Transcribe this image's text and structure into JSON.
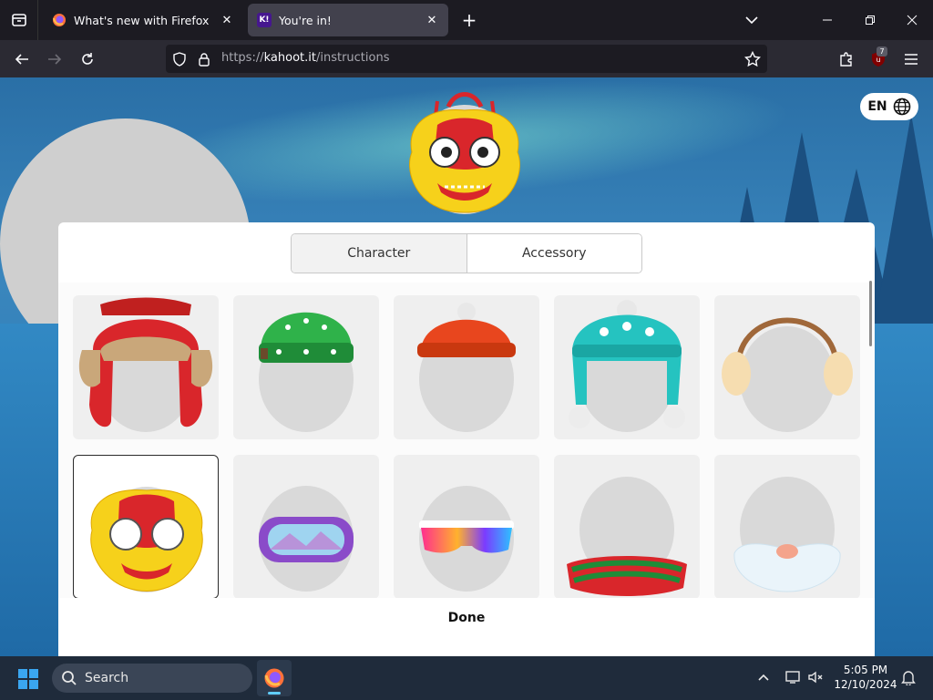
{
  "browser": {
    "tabs": [
      {
        "title": "What's new with Firefox",
        "active": false,
        "favicon": "firefox-icon"
      },
      {
        "title": "You're in!",
        "active": true,
        "favicon": "kahoot-icon",
        "favicon_text": "K!"
      }
    ],
    "url_prefix": "https://",
    "url_host": "kahoot.it",
    "url_path": "/instructions",
    "extension_badge": "7"
  },
  "page": {
    "language": "EN",
    "segmented": {
      "options": [
        "Character",
        "Accessory"
      ],
      "selected": "Character"
    },
    "done_label": "Done",
    "accessories": [
      {
        "name": "trapper-hat",
        "selected": false
      },
      {
        "name": "reindeer-beanie",
        "selected": false
      },
      {
        "name": "orange-beanie",
        "selected": false
      },
      {
        "name": "snowflake-bobble-hat",
        "selected": false
      },
      {
        "name": "earmuffs",
        "selected": false
      },
      {
        "name": "lion-dance-mask",
        "selected": true
      },
      {
        "name": "ski-goggles",
        "selected": false
      },
      {
        "name": "sport-sunglasses",
        "selected": false
      },
      {
        "name": "striped-scarf",
        "selected": false
      },
      {
        "name": "white-beard",
        "selected": false
      }
    ]
  },
  "taskbar": {
    "search_label": "Search",
    "time": "5:05 PM",
    "date": "12/10/2024"
  },
  "colors": {
    "accent": "#60cdff",
    "mask_red": "#d9262b",
    "mask_yellow": "#f6d11b",
    "head_gray": "#d9d9d9"
  }
}
